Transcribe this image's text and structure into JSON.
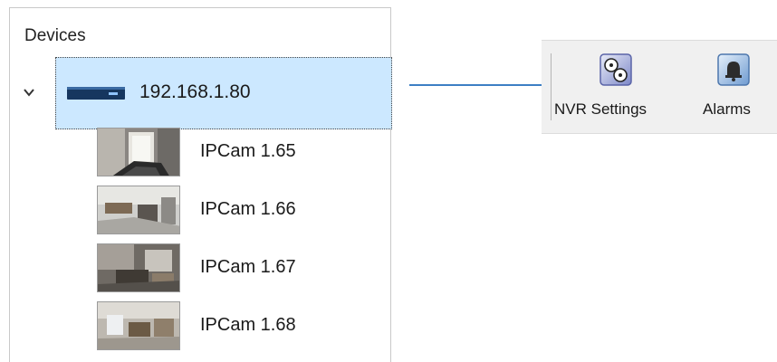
{
  "device_tree": {
    "title": "Devices",
    "nvr": {
      "label": "192.168.1.80",
      "icon": "nvr-recorder-icon",
      "expanded": true,
      "selected": true
    },
    "cameras": [
      {
        "label": "IPCam 1.65",
        "icon": "camera-thumbnail"
      },
      {
        "label": "IPCam 1.66",
        "icon": "camera-thumbnail"
      },
      {
        "label": "IPCam 1.67",
        "icon": "camera-thumbnail"
      },
      {
        "label": "IPCam 1.68",
        "icon": "camera-thumbnail"
      }
    ]
  },
  "toolbar": {
    "items": [
      {
        "label": "NVR Settings",
        "icon": "film-reels-icon"
      },
      {
        "label": "Alarms",
        "icon": "bell-icon"
      }
    ]
  },
  "colors": {
    "selection": "#cce8ff",
    "arrow": "#3d7fc4",
    "toolbar_bg": "#f0f0f0"
  }
}
